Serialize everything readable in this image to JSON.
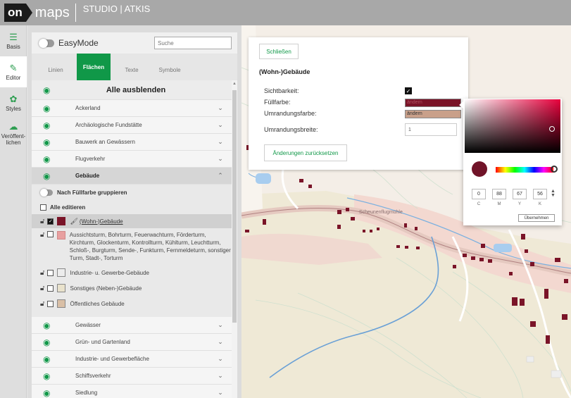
{
  "header": {
    "logo_on": "on",
    "logo_maps": "maps",
    "title": "STUDIO | ATKIS"
  },
  "rail": [
    {
      "label": "Basis",
      "icon": "☰"
    },
    {
      "label": "Editor",
      "icon": "✎"
    },
    {
      "label": "Styles",
      "icon": "✿"
    },
    {
      "label": "Veröffent-lichen",
      "icon": "☁"
    }
  ],
  "panel": {
    "easymode_label": "EasyMode",
    "search_placeholder": "Suche",
    "tabs": [
      "Linien",
      "Flächen",
      "Texte",
      "Symbole"
    ],
    "hide_all": "Alle ausblenden",
    "categories_top": [
      "Ackerland",
      "Archäologische Fundstätte",
      "Bauwerk an Gewässern",
      "Flugverkehr"
    ],
    "expanded_category": "Gebäude",
    "group_by_fill": "Nach Füllfarbe gruppieren",
    "edit_all": "Alle editieren",
    "items": [
      {
        "label": "(Wohn-)Gebäude",
        "color": "#7a1428"
      },
      {
        "label": "Aussichtsturm, Bohrturm, Feuerwachturm, Förderturm, Kirchturm, Glockenturm, Kontrollturm, Kühlturm, Leuchtturm, Schloß-, Burgturm, Sende-, Funkturm, Fernmeldeturm, sonstiger Turm, Stadt-, Torturm",
        "color": "#e8a0a0"
      },
      {
        "label": "Industrie- u. Gewerbe-Gebäude",
        "color": "#ececec"
      },
      {
        "label": "Sonstiges (Neben-)Gebäude",
        "color": "#e9e2cc"
      },
      {
        "label": "Öffentliches Gebäude",
        "color": "#d9bfa6"
      }
    ],
    "categories_bottom": [
      "Gewässer",
      "Grün- und Gartenland",
      "Industrie- und Gewerbefläche",
      "Schiffsverkehr",
      "Siedlung"
    ]
  },
  "dialog": {
    "close_label": "Schließen",
    "title": "(Wohn-)Gebäude",
    "visibility_label": "Sichtbarkeit:",
    "fill_label": "Füllfarbe:",
    "fill_value": "ändern",
    "fill_color": "#7a1428",
    "outline_label": "Umrandungsfarbe:",
    "outline_value": "ändern",
    "outline_color": "#c9a08a",
    "width_label": "Umrandungsbreite:",
    "width_value": "1",
    "reset_label": "Änderungen zurücksetzen"
  },
  "picker": {
    "c": "0",
    "m": "88",
    "y": "67",
    "k": "56",
    "c_label": "C",
    "m_label": "M",
    "y_label": "Y",
    "k_label": "K",
    "apply_label": "Übernehmen",
    "preview_color": "#701328"
  },
  "map": {
    "label": "Scheunenflugmühle"
  }
}
